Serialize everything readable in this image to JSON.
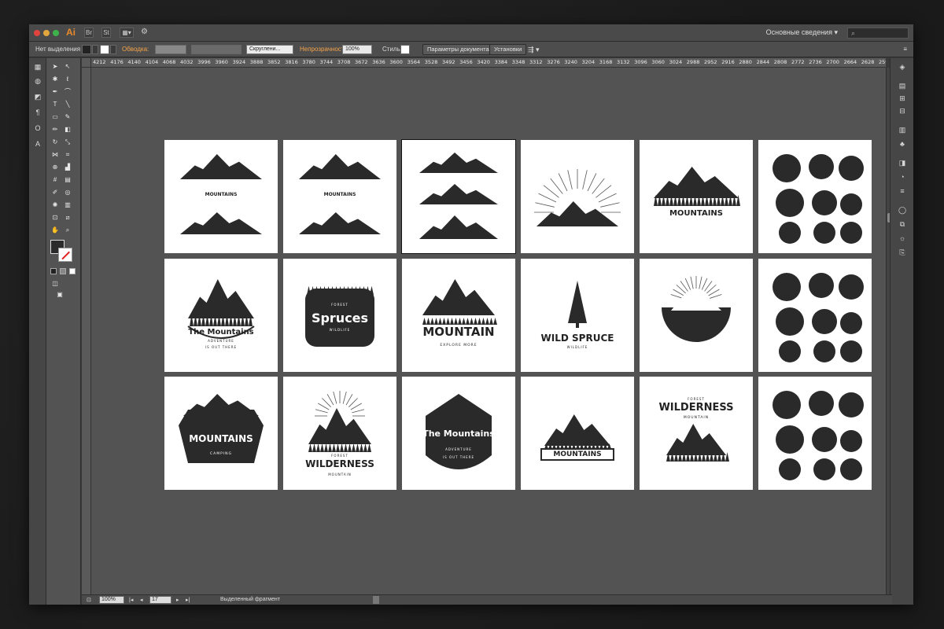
{
  "app": {
    "logo": "Ai",
    "arrange_button": "St",
    "workspace": "Основные сведения",
    "search_placeholder": ""
  },
  "control_bar": {
    "selection_state": "Нет выделения",
    "stroke_label": "Обводка:",
    "brush_value": "Скруглени...",
    "opacity_label": "Непрозрачность:",
    "opacity_value": "100%",
    "style_label": "Стиль:",
    "doc_setup_button": "Параметры документа",
    "preferences_button": "Установки"
  },
  "ruler": {
    "ticks": [
      "4212",
      "4176",
      "4140",
      "4104",
      "4068",
      "4032",
      "3996",
      "3960",
      "3924",
      "3888",
      "3852",
      "3816",
      "3780",
      "3744",
      "3708",
      "3672",
      "3636",
      "3600",
      "3564",
      "3528",
      "3492",
      "3456",
      "3420",
      "3384",
      "3348",
      "3312",
      "3276",
      "3240",
      "3204",
      "3168",
      "3132",
      "3096",
      "3060",
      "3024",
      "2988",
      "2952",
      "2916",
      "2880",
      "2844",
      "2808",
      "2772",
      "2736",
      "2700",
      "2664",
      "2628",
      "2592"
    ]
  },
  "status_bar": {
    "zoom": "100%",
    "artboard_number": "17",
    "current_tool": "Выделенный фрагмент"
  },
  "artboards": [
    {
      "title": "MOUNTAINS",
      "style": "rows"
    },
    {
      "title": "MOUNTAINS",
      "style": "rows"
    },
    {
      "title": "",
      "style": "three"
    },
    {
      "title": "",
      "style": "sunrise"
    },
    {
      "title": "MOUNTAINS",
      "style": "forest"
    },
    {
      "title": "",
      "style": "set"
    },
    {
      "title": "The Mountains",
      "sub": "ADVENTURE",
      "sub2": "IS OUT THERE",
      "style": "badge"
    },
    {
      "title": "Spruces",
      "sub": "FOREST",
      "sub2": "WILDLIFE",
      "style": "dark"
    },
    {
      "title": "MOUNTAIN",
      "sub": "EXPLORE MORE",
      "style": "peak"
    },
    {
      "title": "WILD SPRUCE",
      "sub": "WILDLIFE",
      "style": "tree"
    },
    {
      "title": "",
      "style": "circle"
    },
    {
      "title": "",
      "style": "set"
    },
    {
      "title": "MOUNTAINS",
      "sub": "CAMPING",
      "style": "hex"
    },
    {
      "title": "WILDERNESS",
      "sub": "FOREST",
      "sub2": "MOUNTAIN",
      "style": "sunpeak"
    },
    {
      "title": "The Mountains",
      "sub": "ADVENTURE",
      "sub2": "IS OUT THERE",
      "style": "shield"
    },
    {
      "title": "MOUNTAINS",
      "style": "ribbon"
    },
    {
      "title": "WILDERNESS",
      "sub": "FOREST",
      "sub2": "MOUNTAIN",
      "style": "wild"
    },
    {
      "title": "",
      "style": "set"
    }
  ]
}
